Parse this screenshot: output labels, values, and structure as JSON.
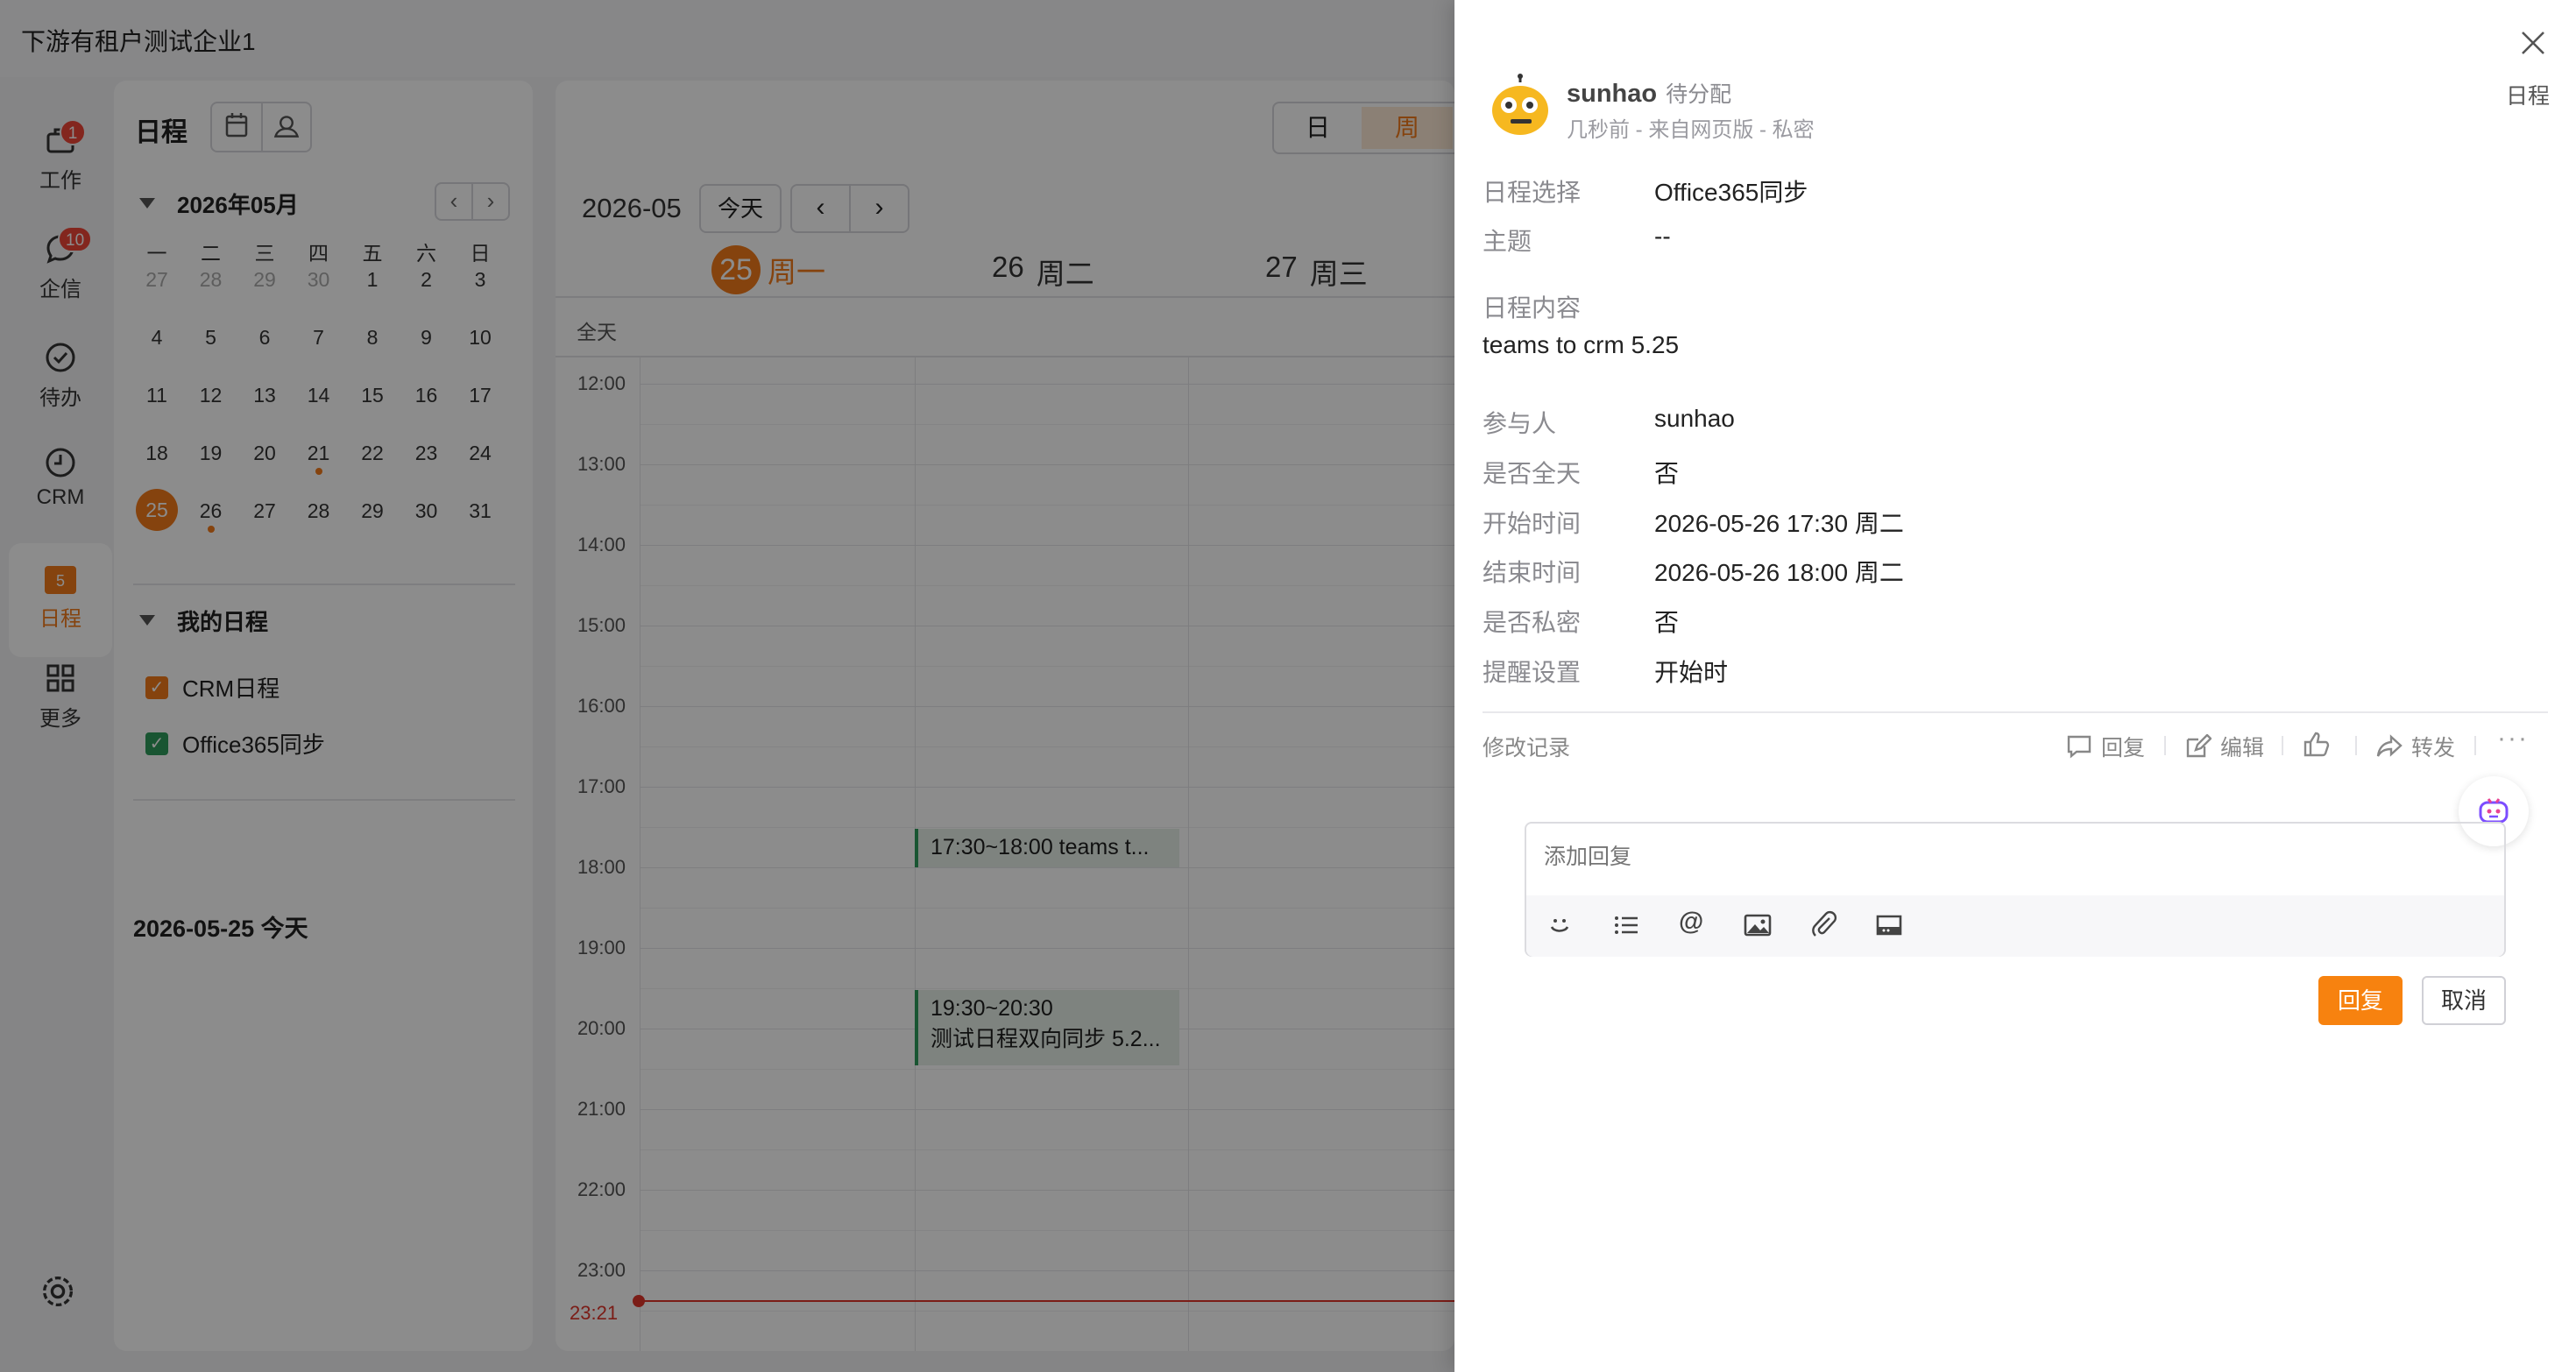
{
  "app": {
    "title": "下游有租户测试企业1"
  },
  "nav": {
    "items": [
      {
        "label": "工作",
        "badge": "1"
      },
      {
        "label": "企信",
        "badge": "10"
      },
      {
        "label": "待办"
      },
      {
        "label": "CRM"
      },
      {
        "label": "日程",
        "day": "5"
      },
      {
        "label": "更多"
      }
    ]
  },
  "side": {
    "title": "日程",
    "month_label": "2026年05月",
    "weekdays": [
      "一",
      "二",
      "三",
      "四",
      "五",
      "六",
      "日"
    ],
    "weeks": [
      [
        "27",
        "28",
        "29",
        "30",
        "1",
        "2",
        "3"
      ],
      [
        "4",
        "5",
        "6",
        "7",
        "8",
        "9",
        "10"
      ],
      [
        "11",
        "12",
        "13",
        "14",
        "15",
        "16",
        "17"
      ],
      [
        "18",
        "19",
        "20",
        "21",
        "22",
        "23",
        "24"
      ],
      [
        "25",
        "26",
        "27",
        "28",
        "29",
        "30",
        "31"
      ]
    ],
    "my_calendars_label": "我的日程",
    "calendars": [
      {
        "name": "CRM日程",
        "color": "#f27a1a"
      },
      {
        "name": "Office365同步",
        "color": "#2e9c5b"
      }
    ],
    "today_label": "2026-05-25 今天"
  },
  "calendar": {
    "view_day": "日",
    "view_week": "周",
    "month": "2026-05",
    "today_btn": "今天",
    "days": [
      {
        "num": "25",
        "name": "周一"
      },
      {
        "num": "26",
        "name": "周二"
      },
      {
        "num": "27",
        "name": "周三"
      }
    ],
    "allday_label": "全天",
    "hours": [
      "12:00",
      "13:00",
      "14:00",
      "15:00",
      "16:00",
      "17:00",
      "18:00",
      "19:00",
      "20:00",
      "21:00",
      "22:00",
      "23:00"
    ],
    "now_label": "23:21",
    "events": [
      {
        "line1": "17:30~18:00   teams t..."
      },
      {
        "line1": "19:30~20:30",
        "line2": "测试日程双向同步 5.2..."
      }
    ]
  },
  "detail": {
    "user": "sunhao",
    "status": "待分配",
    "meta": "几秒前 - 来自网页版 - 私密",
    "type_tag": "日程",
    "fields": {
      "calendar_label": "日程选择",
      "calendar_value": "Office365同步",
      "subject_label": "主题",
      "subject_value": "--",
      "content_label": "日程内容",
      "content_value": "teams to crm 5.25",
      "participants_label": "参与人",
      "participants_value": "sunhao",
      "allday_label": "是否全天",
      "allday_value": "否",
      "start_label": "开始时间",
      "start_value": "2026-05-26 17:30 周二",
      "end_label": "结束时间",
      "end_value": "2026-05-26 18:00 周二",
      "private_label": "是否私密",
      "private_value": "否",
      "remind_label": "提醒设置",
      "remind_value": "开始时"
    },
    "history_label": "修改记录",
    "actions": {
      "reply": "回复",
      "edit": "编辑",
      "forward": "转发"
    },
    "reply_placeholder": "添加回复",
    "submit": "回复",
    "cancel": "取消"
  },
  "colors": {
    "accent": "#f27a1a",
    "green": "#2e9c5b",
    "badge": "#ee4637"
  }
}
